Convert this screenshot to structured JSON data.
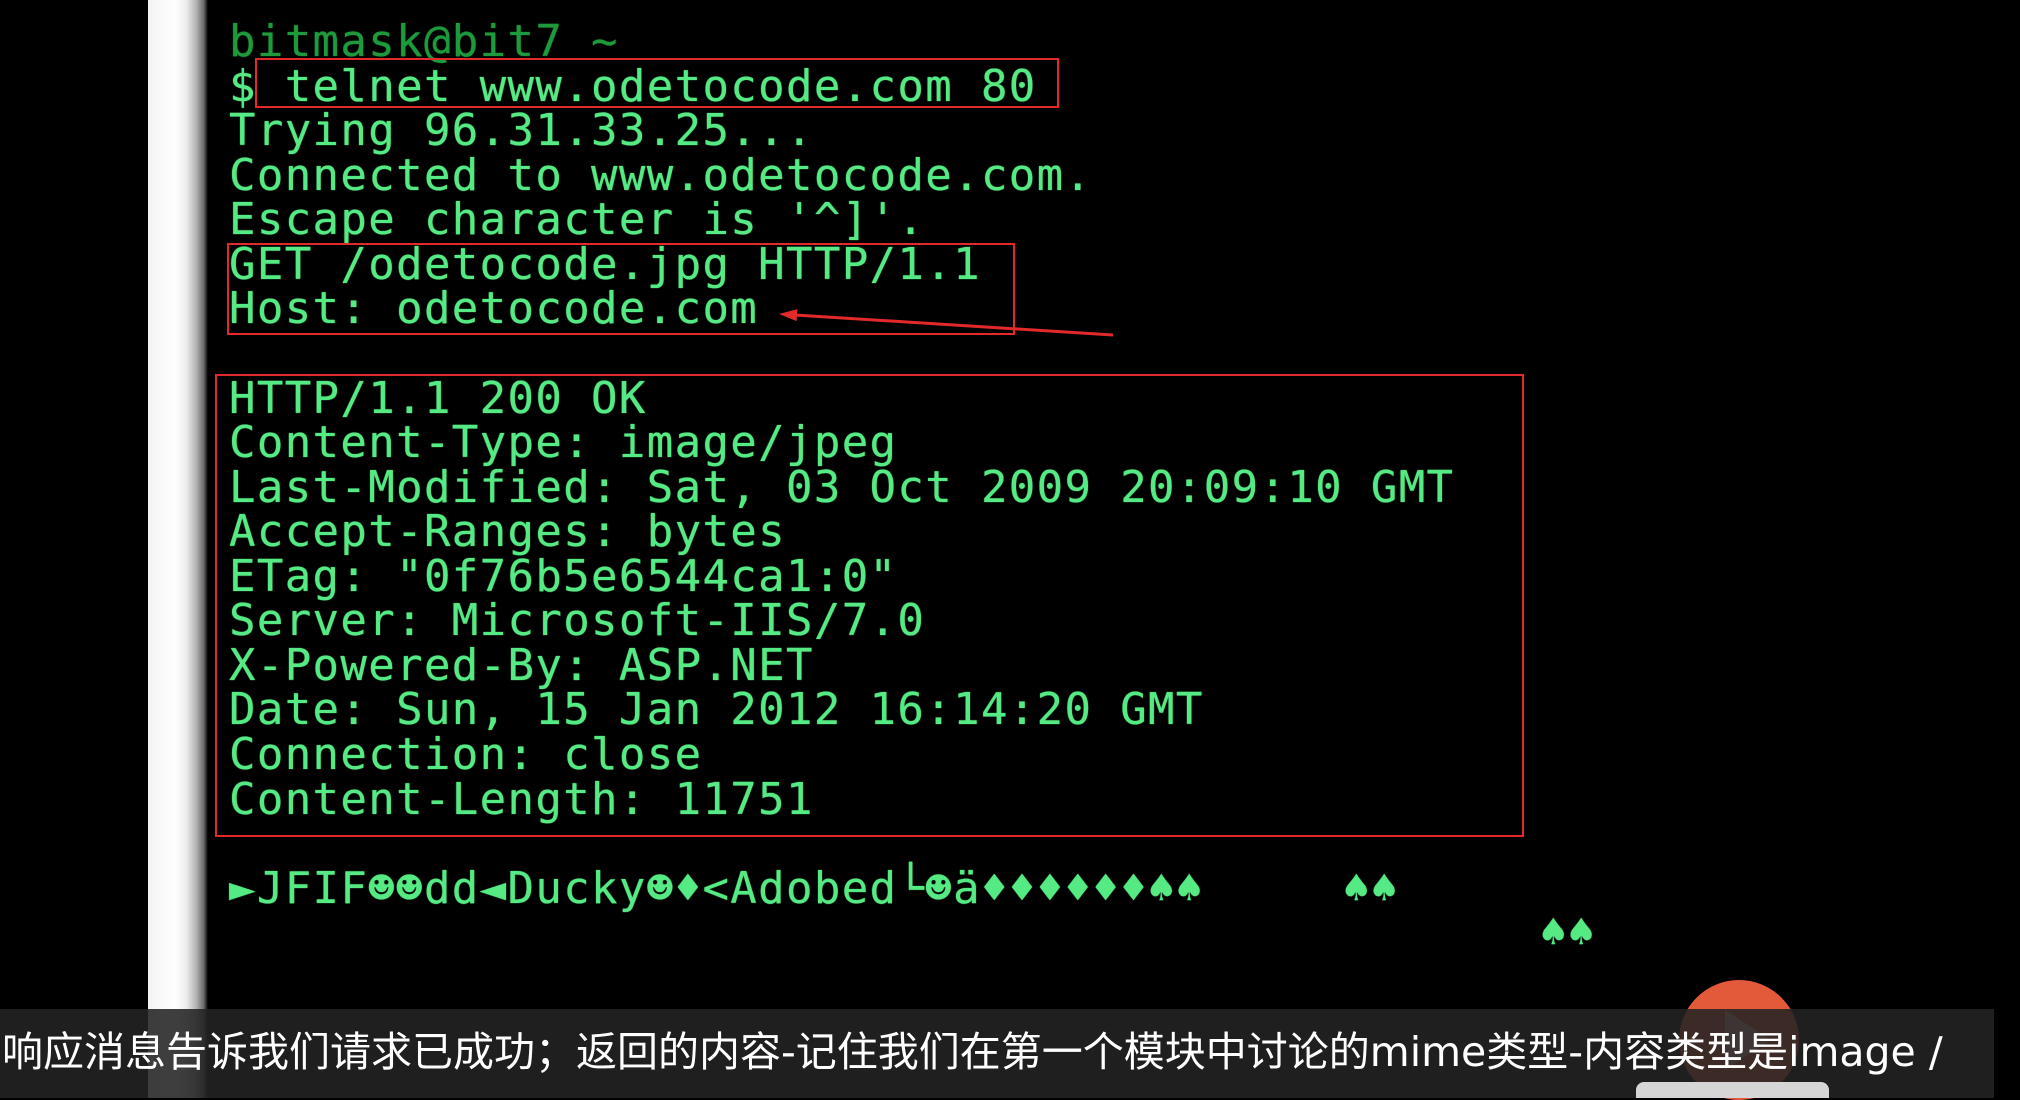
{
  "terminal": {
    "prompt": "bitmask@bit7 ~",
    "prompt_symbol": "$",
    "command": "telnet www.odetocode.com 80",
    "connection_output": [
      "Trying 96.31.33.25...",
      "Connected to www.odetocode.com.",
      "Escape character is '^]'."
    ],
    "request": {
      "request_line": "GET /odetocode.jpg HTTP/1.1",
      "host_header": "Host: odetocode.com"
    },
    "response": {
      "status_line": "HTTP/1.1 200 OK",
      "headers": [
        "Content-Type: image/jpeg",
        "Last-Modified: Sat, 03 Oct 2009 20:09:10 GMT",
        "Accept-Ranges: bytes",
        "ETag: \"0f76b5e6544ca1:0\"",
        "Server: Microsoft-IIS/7.0",
        "X-Powered-By: ASP.NET",
        "Date: Sun, 15 Jan 2012 16:14:20 GMT",
        "Connection: close",
        "Content-Length: 11751"
      ]
    },
    "body_bytes": [
      "►JFIF☻☻dd◄Ducky☻♦<Adobed└☻ä♦♦♦♦♦♦♠♠",
      "♠♠",
      "♠♠"
    ]
  },
  "subtitle": "响应消息告诉我们请求已成功；返回的内容-记住我们在第一个模块中讨论的mime类型-内容类型是image /",
  "player": {
    "play_icon": "play-icon"
  },
  "colors": {
    "terminal_text": "#55ea84",
    "prompt_text": "#1d9a3c",
    "annotation": "#e32a2a",
    "play_button": "#e25a3a",
    "subtitle_text": "#ffffff"
  }
}
